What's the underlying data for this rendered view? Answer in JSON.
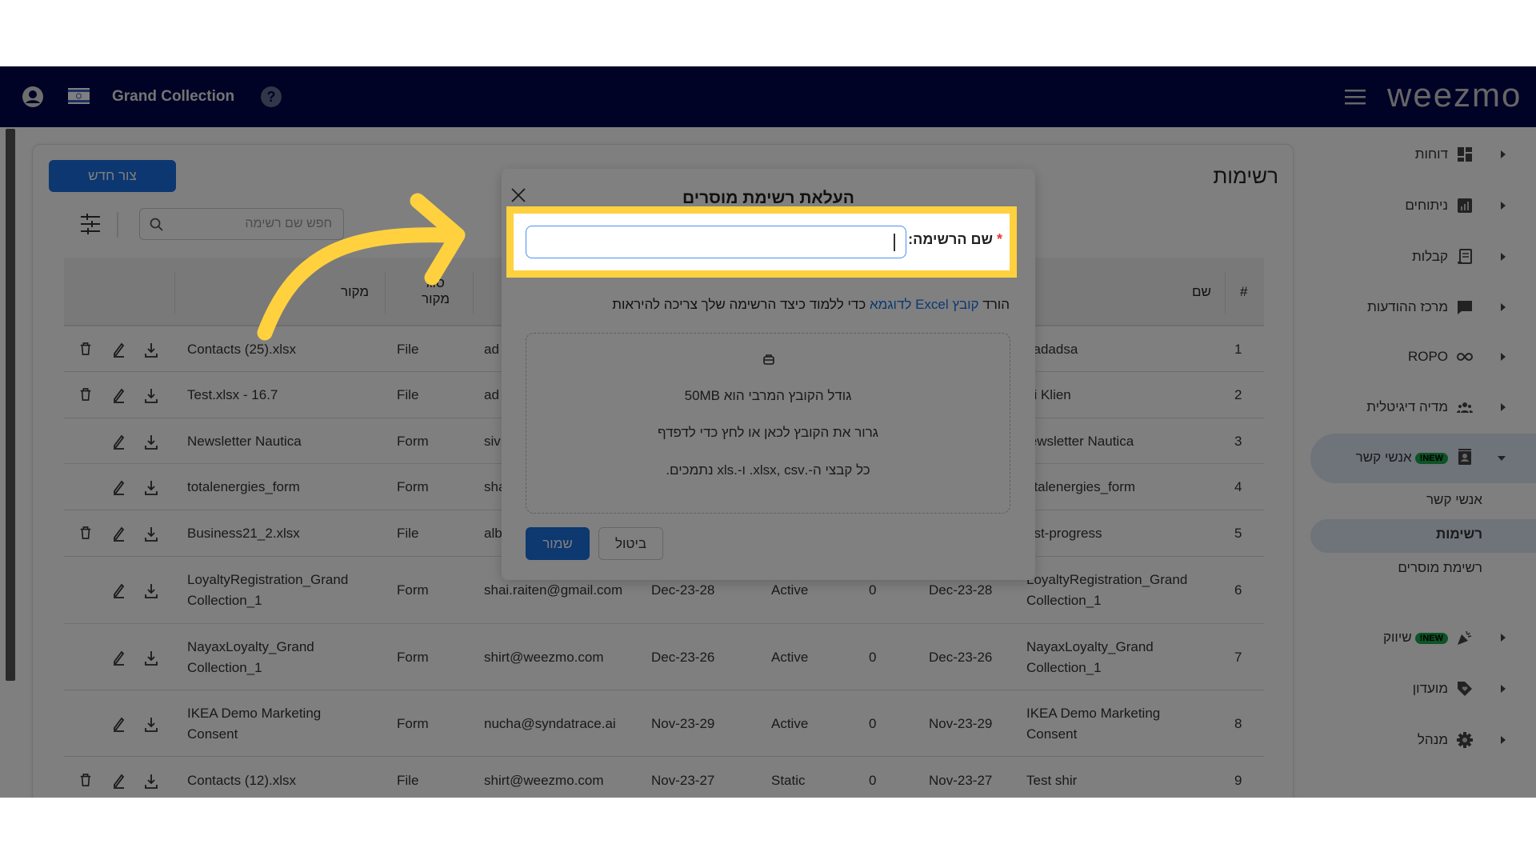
{
  "header": {
    "brand": "Grand Collection",
    "logo": "weezmo",
    "logo_accent": "#1aa64b",
    "icons": [
      "user-circle-icon",
      "israel-flag-icon",
      "help-icon",
      "hamburger-menu-icon"
    ]
  },
  "page": {
    "title": "רשימות",
    "create_button": "צור חדש",
    "search_placeholder": "חפש שם רשימה"
  },
  "table": {
    "headers": {
      "index": "#",
      "name": "שם",
      "source_type": "סוג\nמקור",
      "source": "מקור"
    },
    "rows": [
      {
        "index": "1",
        "name": "xadadsa",
        "email": "ad",
        "source_type": "File",
        "source": "Contacts (25).xlsx",
        "delete": true
      },
      {
        "index": "2",
        "name": "di Klien",
        "email": "ad",
        "source_type": "File",
        "source": "Test.xlsx - 16.7",
        "delete": true
      },
      {
        "index": "3",
        "name": "lewsletter Nautica",
        "email": "siv",
        "source_type": "Form",
        "source": "Newsletter Nautica",
        "delete": false
      },
      {
        "index": "4",
        "name": "otalenergies_form",
        "email": "sha",
        "source_type": "Form",
        "source": "totalenergies_form",
        "delete": false
      },
      {
        "index": "5",
        "name": "est-progress",
        "email": "alb",
        "source_type": "File",
        "source": "Business21_2.xlsx",
        "delete": true
      },
      {
        "index": "6",
        "name": "LoyaltyRegistration_Grand Collection_1",
        "updated": "Dec-23-28",
        "count": "0",
        "status": "Active",
        "created": "Dec-23-28",
        "email": "shai.raiten@gmail.com",
        "source_type": "Form",
        "source": "LoyaltyRegistration_Grand Collection_1",
        "delete": false,
        "tall": true
      },
      {
        "index": "7",
        "name": "NayaxLoyalty_Grand Collection_1",
        "updated": "Dec-23-26",
        "count": "0",
        "status": "Active",
        "created": "Dec-23-26",
        "email": "shirt@weezmo.com",
        "source_type": "Form",
        "source": "NayaxLoyalty_Grand Collection_1",
        "delete": false,
        "tall": true
      },
      {
        "index": "8",
        "name": "IKEA Demo Marketing Consent",
        "updated": "Nov-23-29",
        "count": "0",
        "status": "Active",
        "created": "Nov-23-29",
        "email": "nucha@syndatrace.ai",
        "source_type": "Form",
        "source": "IKEA Demo Marketing Consent",
        "delete": false,
        "tall": true
      },
      {
        "index": "9",
        "name": "Test shir",
        "updated": "Nov-23-27",
        "count": "0",
        "status": "Static",
        "created": "Nov-23-27",
        "email": "shirt@weezmo.com",
        "source_type": "File",
        "source": "Contacts (12).xlsx",
        "delete": true
      }
    ]
  },
  "sidebar": {
    "items": [
      {
        "label": "דוחות",
        "icon": "dashboard-icon"
      },
      {
        "label": "ניתוחים",
        "icon": "bar-chart-icon"
      },
      {
        "label": "קבלות",
        "icon": "receipt-icon"
      },
      {
        "label": "מרכז ההודעות",
        "icon": "chat-icon"
      },
      {
        "label": "ROPO",
        "icon": "infinity-icon"
      },
      {
        "label": "מדיה דיגיטלית",
        "icon": "people-icon"
      },
      {
        "label": "אנשי קשר",
        "icon": "contact-book-icon",
        "badge": "NEW!",
        "expanded": true
      },
      {
        "label": "שיווק",
        "icon": "party-popper-icon",
        "badge": "NEW!"
      },
      {
        "label": "מועדון",
        "icon": "tag-heart-icon"
      },
      {
        "label": "מנהל",
        "icon": "gear-icon"
      }
    ],
    "subitems": [
      {
        "label": "אנשי קשר"
      },
      {
        "label": "רשימות",
        "active": true
      },
      {
        "label": "רשימת מוסרים"
      }
    ]
  },
  "modal": {
    "title": "העלאת רשימת מוסרים",
    "name_label": "שם הרשימה:",
    "required_mark": "*",
    "name_value": "",
    "instructions_prefix": "הורד ",
    "instructions_link": "קובץ Excel לדוגמא",
    "instructions_suffix": " כדי ללמוד כיצד הרשימה שלך צריכה להיראות",
    "drop_max_size": "גודל הקובץ המרבי הוא 50MB",
    "drop_hint": "גרור את הקובץ לכאן או לחץ כדי לדפדף",
    "drop_formats": "כל קבצי ה-.xlsx, csv. ו-.xls נתמכים.",
    "save": "שמור",
    "cancel": "ביטול"
  },
  "colors": {
    "primary": "#1a6fe0",
    "highlight": "#ffd13f",
    "header": "#00044d",
    "badge": "#1aa64b"
  }
}
